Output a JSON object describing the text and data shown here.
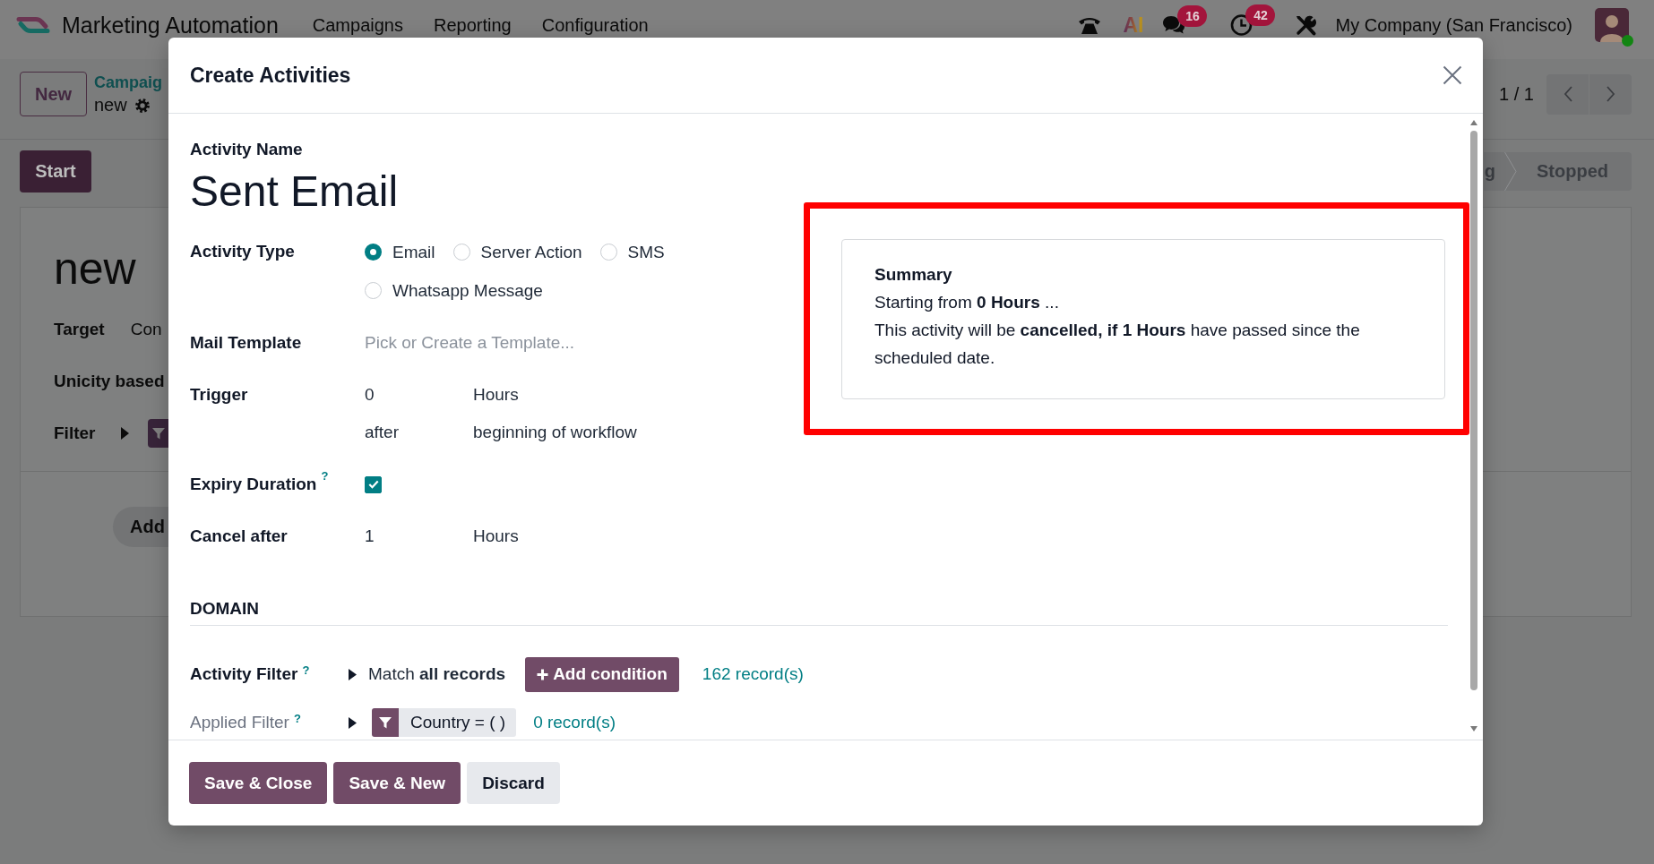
{
  "navbar": {
    "app_name": "Marketing Automation",
    "menu": [
      "Campaigns",
      "Reporting",
      "Configuration"
    ],
    "ai_button": "AI",
    "messages_badge": "16",
    "activities_badge": "42",
    "company": "My Company (San Francisco)"
  },
  "control_panel": {
    "new_button": "New",
    "breadcrumb": "Campaig",
    "record": "new",
    "pager": "1 / 1"
  },
  "record": {
    "start_button": "Start",
    "stages": [
      {
        "label": "g",
        "selected": false
      },
      {
        "label": "Stopped",
        "selected": false
      }
    ],
    "title": "new",
    "fields": [
      {
        "kind": "text",
        "label": "Target",
        "value": "Con"
      },
      {
        "kind": "label",
        "label": "Unicity based"
      },
      {
        "kind": "filter",
        "label": "Filter"
      }
    ],
    "add_button": "Add"
  },
  "dialog": {
    "title": "Create Activities",
    "name_label": "Activity Name",
    "name": "Sent Email",
    "activity_type": {
      "label": "Activity Type",
      "options": [
        {
          "label": "Email",
          "selected": true
        },
        {
          "label": "Server Action",
          "selected": false
        },
        {
          "label": "SMS",
          "selected": false
        },
        {
          "label": "Whatsapp Message",
          "selected": false
        }
      ]
    },
    "mail_template": {
      "label": "Mail Template",
      "placeholder": "Pick or Create a Template..."
    },
    "trigger": {
      "label": "Trigger",
      "interval": "0",
      "unit": "Hours",
      "direction": "after",
      "event": "beginning of workflow"
    },
    "expiry_duration": {
      "label": "Expiry Duration",
      "help": "?",
      "checked": true
    },
    "cancel_after": {
      "label": "Cancel after",
      "interval": "1",
      "unit": "Hours"
    },
    "summary": {
      "highlighted": true,
      "title": "Summary",
      "lines": [
        "Starting from **0 Hours** ...",
        "This activity will be **cancelled, if 1 Hours** have passed since the scheduled date."
      ]
    },
    "domain": {
      "heading": "DOMAIN",
      "activity_filter": {
        "label": "Activity Filter",
        "help": "?",
        "readonly": false,
        "match": "Match **all records**",
        "add_button": "Add condition",
        "count": "162 record(s)"
      },
      "applied_filter": {
        "label": "Applied Filter",
        "help": "?",
        "readonly": true,
        "tag": "Country = ( )",
        "count": "0 record(s)"
      }
    },
    "buttons": [
      {
        "label": "Save & Close",
        "kind": "primary"
      },
      {
        "label": "Save & New",
        "kind": "primary"
      },
      {
        "label": "Discard",
        "kind": "secondary"
      }
    ]
  }
}
